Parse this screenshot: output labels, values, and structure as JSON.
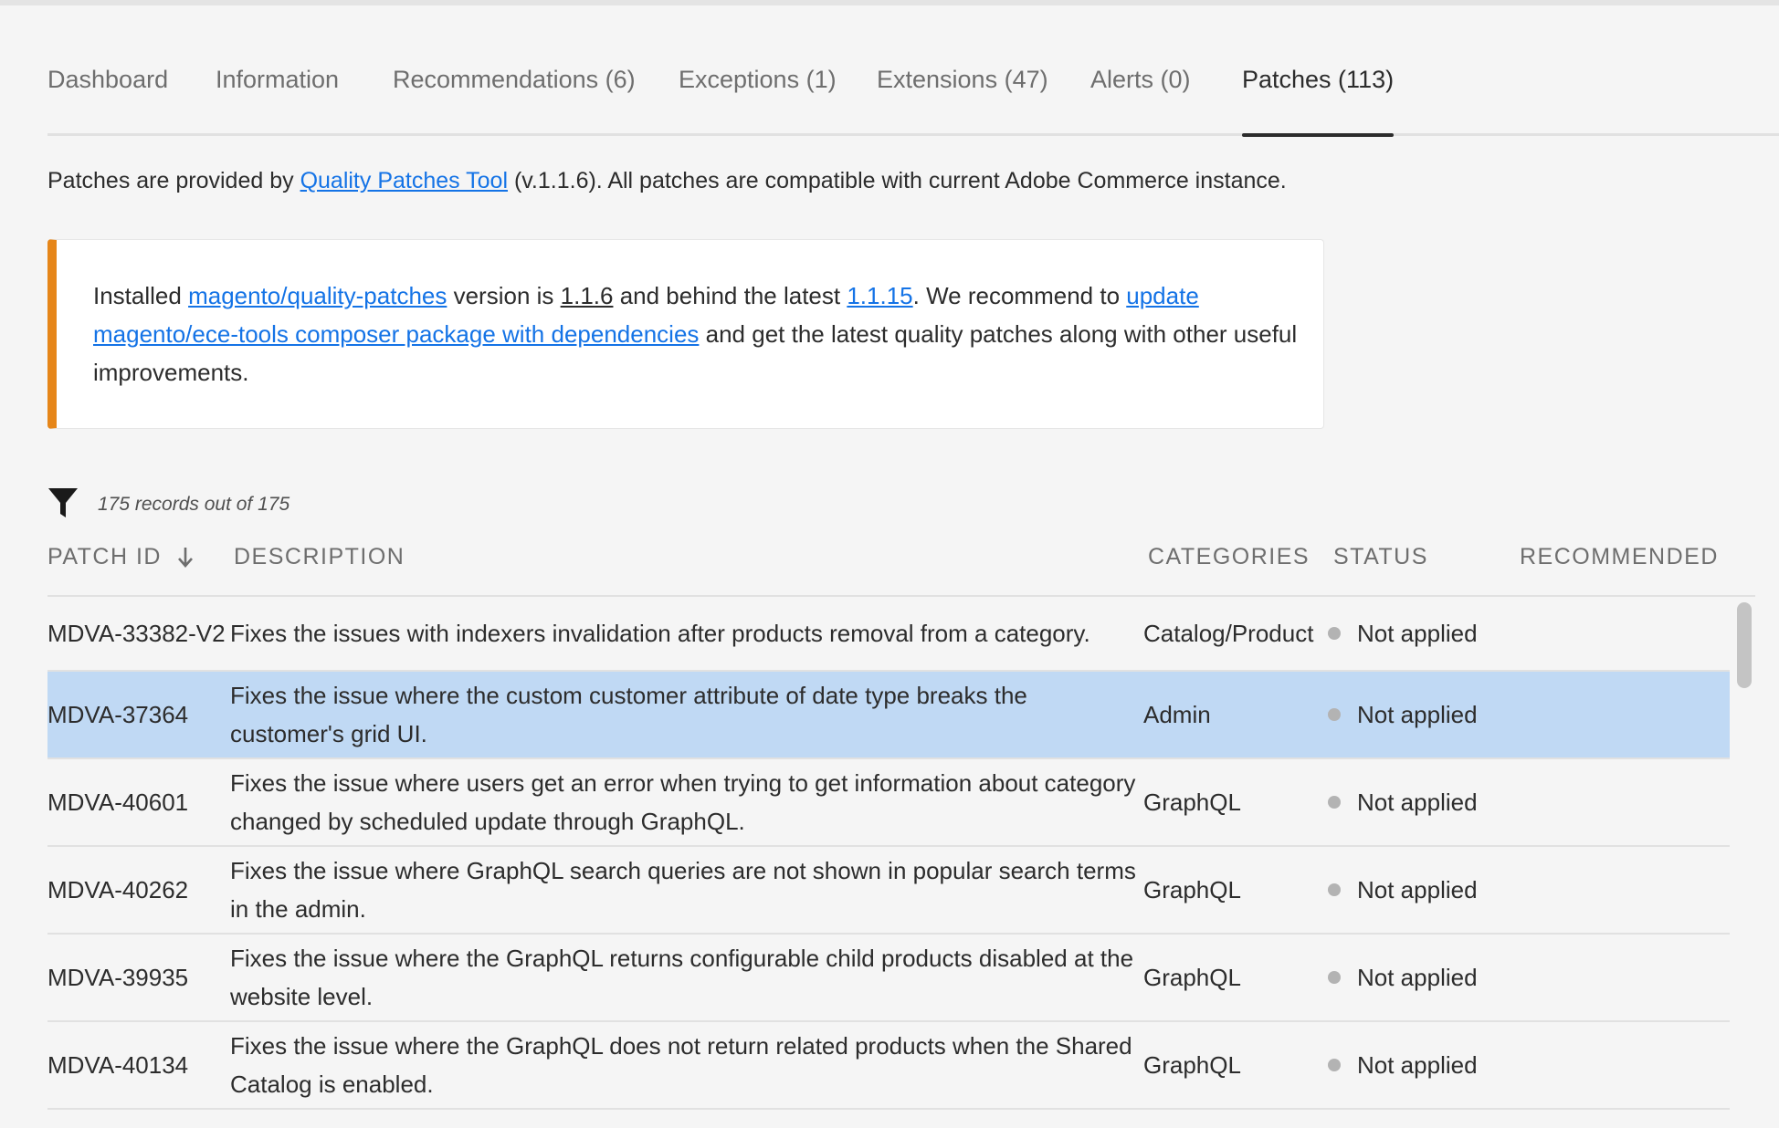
{
  "tabs": [
    {
      "label": "Dashboard"
    },
    {
      "label": "Information"
    },
    {
      "label": "Recommendations (6)"
    },
    {
      "label": "Exceptions (1)"
    },
    {
      "label": "Extensions (47)"
    },
    {
      "label": "Alerts (0)"
    },
    {
      "label": "Patches (113)",
      "active": true
    }
  ],
  "intro": {
    "prefix": "Patches are provided by ",
    "link": "Quality Patches Tool",
    "suffix": " (v.1.1.6). All patches are compatible with current Adobe Commerce instance."
  },
  "notice": {
    "accent_color": "#e68619",
    "t1": "Installed ",
    "link_package": "magento/quality-patches",
    "t2": " version is ",
    "installed_version": "1.1.6",
    "t3": " and behind the latest ",
    "latest_version": "1.1.15",
    "t4": ". We recommend to ",
    "link_update": "update magento/ece-tools composer package with dependencies",
    "t5": " and get the latest quality patches along with other useful improvements."
  },
  "filter": {
    "icon": "filter-icon",
    "count_text": "175 records out of 175"
  },
  "table": {
    "headers": {
      "patch_id": "PATCH ID",
      "description": "DESCRIPTION",
      "categories": "CATEGORIES",
      "status": "STATUS",
      "recommended": "RECOMMENDED"
    },
    "sort_icon": "arrow-down-icon",
    "rows": [
      {
        "id": "MDVA-33382-V2",
        "description": "Fixes the issues with indexers invalidation after products removal from a category.",
        "category": "Catalog/Product",
        "status": "Not applied",
        "recommended": ""
      },
      {
        "id": "MDVA-37364",
        "description": "Fixes the issue where the custom customer attribute of date type breaks the customer's grid UI.",
        "category": "Admin",
        "status": "Not applied",
        "recommended": "",
        "selected": true
      },
      {
        "id": "MDVA-40601",
        "description": "Fixes the issue where users get an error when trying to get information about category changed by scheduled update through GraphQL.",
        "category": "GraphQL",
        "status": "Not applied",
        "recommended": ""
      },
      {
        "id": "MDVA-40262",
        "description": "Fixes the issue where GraphQL search queries are not shown in popular search terms in the admin.",
        "category": "GraphQL",
        "status": "Not applied",
        "recommended": ""
      },
      {
        "id": "MDVA-39935",
        "description": "Fixes the issue where the GraphQL returns configurable child products disabled at the website level.",
        "category": "GraphQL",
        "status": "Not applied",
        "recommended": ""
      },
      {
        "id": "MDVA-40134",
        "description": "Fixes the issue where the GraphQL does not return related products when the Shared Catalog is enabled.",
        "category": "GraphQL",
        "status": "Not applied",
        "recommended": ""
      }
    ]
  },
  "colors": {
    "link": "#1473e6",
    "selected_row": "#c0d9f4",
    "status_dot": "#b3b3b3"
  }
}
